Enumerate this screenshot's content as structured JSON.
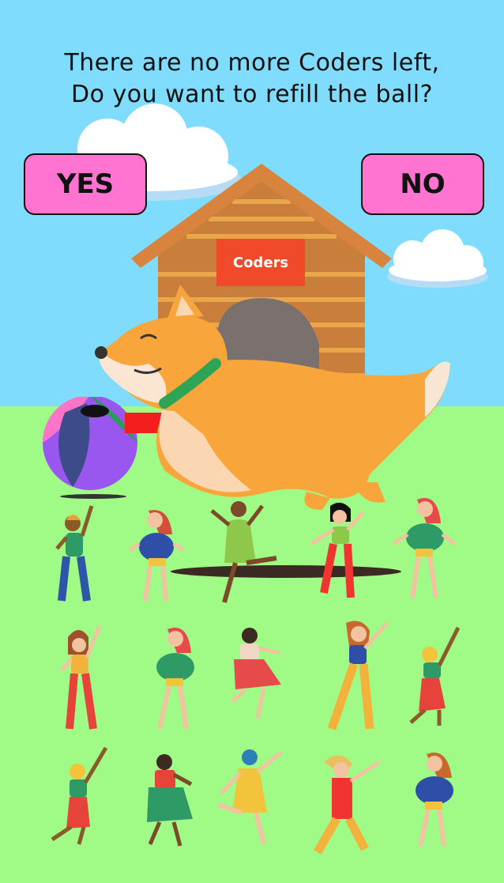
{
  "dialog": {
    "prompt_line1": "There are no more Coders left,",
    "prompt_line2": "Do you want to refill the ball?",
    "yes_label": "YES",
    "no_label": "NO"
  },
  "scene": {
    "house_sign": "Coders",
    "dancer_count": 15
  },
  "colors": {
    "sky": "#7fdcfd",
    "grass": "#9ffb86",
    "button_fill": "#ff74d0",
    "house_wood": "#c97f3b",
    "house_roof": "#d9843e",
    "sign": "#f04a2a",
    "dog": "#f8a63c"
  },
  "icons": {
    "house": "dog-house-icon",
    "dog": "corgi-icon",
    "ball": "beach-ball-icon",
    "dancer": "dancer-figure-icon",
    "cloud": "cloud-icon"
  }
}
